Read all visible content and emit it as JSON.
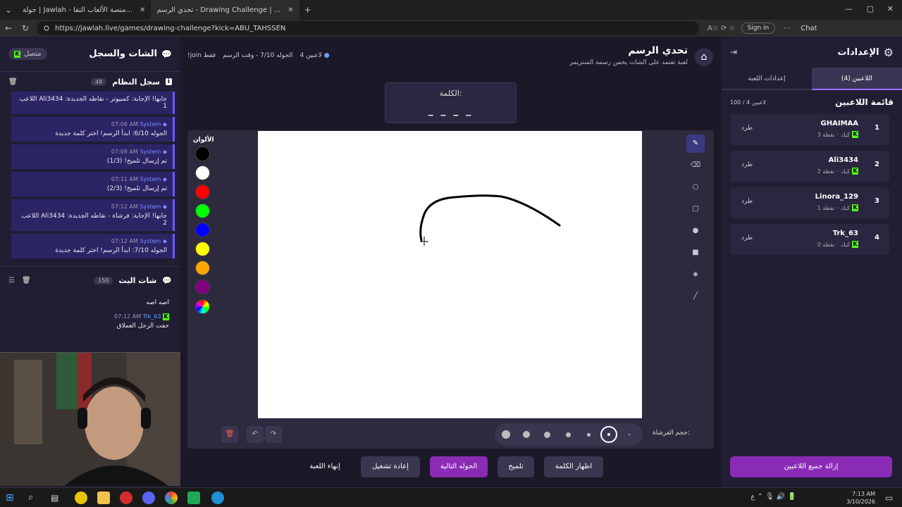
{
  "browser": {
    "tabs": [
      {
        "label": "جولة | Jawlah - منصة الألعاب التفا...",
        "close": "✕"
      },
      {
        "label": "تحدي الرسم - Drawing Challenge | ...",
        "close": "✕"
      }
    ],
    "new_tab": "+",
    "url": "https://jawlah.live/games/drawing-challenge?kick=ABU_TAHSSEN",
    "sign_in": "Sign in",
    "chat": "Chat"
  },
  "left_panel": {
    "title": "الشات والسجل",
    "status": "متصل",
    "system_log": {
      "title": "سجل النظام",
      "count": "48",
      "messages": [
        {
          "time": "",
          "user": "",
          "text": "اللاعب Ali3434 جابها! الإجابة: كمبيوتر - نقاطه الجديدة: 1"
        },
        {
          "time": "07:06 AM",
          "user": "System",
          "text": "الجوله 6/10: ابدأ الرسم! اختر كلمة جديدة"
        },
        {
          "time": "07:09 AM",
          "user": "System",
          "text": "تم إرسال تلميح! (1/3)"
        },
        {
          "time": "07:11 AM",
          "user": "System",
          "text": "تم إرسال تلميح! (2/3)"
        },
        {
          "time": "07:12 AM",
          "user": "System",
          "text": "اللاعب Ali3434 جابها! الإجابة: فرشاة - نقاطه الجديدة: 2"
        },
        {
          "time": "07:12 AM",
          "user": "System",
          "text": "الجوله 7/10: ابدأ الرسم! اختر كلمة جديدة"
        }
      ]
    },
    "stream_chat": {
      "title": "شات البث",
      "count": "150",
      "messages": [
        {
          "time": "",
          "user": "",
          "text": "اصه اصه"
        },
        {
          "time": "07:12 AM",
          "user": "Trk_63",
          "text": "حفت الرجل العملاق"
        }
      ]
    }
  },
  "center": {
    "title": "تحدي الرسم",
    "subtitle": "لعبة تعتمد على الشات يخمن رسمة الستريمر",
    "players_count": "4 لاعبين",
    "round": "الجوله 7/10 - وقت الرسم",
    "join_hint": "!join فقط",
    "word_label": "الكلمة:",
    "word_blanks": "_ _ _ _",
    "colors_label": "الألوان",
    "colors": [
      "#000000",
      "#ffffff",
      "#ff0000",
      "#00ff00",
      "#0000ff",
      "#ffff00",
      "#ffa500",
      "#800080"
    ],
    "brush_label": "حجم الفرشاة:",
    "actions": {
      "end_game": "إنهاء اللعبة",
      "restart": "إعادة تشغيل",
      "next_round": "الجوله التالية",
      "hint": "تلميح",
      "reveal_word": "اظهار الكلمة"
    }
  },
  "right_panel": {
    "title": "الإعدادات",
    "tabs": [
      "اللاعبين (4)",
      "إعدادات اللعبة"
    ],
    "players_title": "قائمة اللاعبين",
    "players_count": "100 / 4 لاعبين",
    "kick_label": "طرد",
    "players": [
      {
        "rank": "1",
        "name": "GHAIMAA",
        "platform": "كيك",
        "points": "3 نقطة"
      },
      {
        "rank": "2",
        "name": "Ali3434",
        "platform": "كيك",
        "points": "2 نقطة"
      },
      {
        "rank": "3",
        "name": "Linora_129",
        "platform": "كيك",
        "points": "1 نقطة"
      },
      {
        "rank": "4",
        "name": "Trk_63",
        "platform": "كيك",
        "points": "0 نقطة"
      }
    ],
    "remove_all": "إزالة جميع اللاعبين"
  },
  "taskbar": {
    "time": "7:13 AM",
    "date": "3/10/2026",
    "lang": "ع"
  }
}
